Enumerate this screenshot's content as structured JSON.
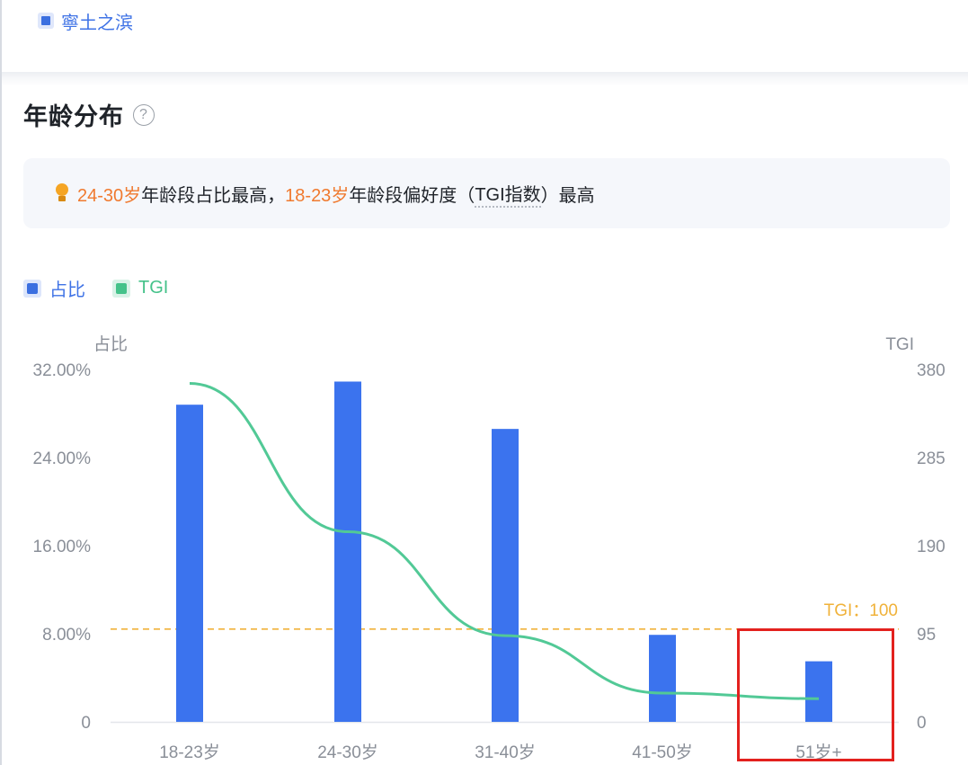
{
  "top_tag": {
    "label": "寧土之滨",
    "icon": "square-tag-icon"
  },
  "section": {
    "title": "年龄分布",
    "help_icon_glyph": "?"
  },
  "insight": {
    "icon": "lightbulb-icon",
    "part1": "24-30岁",
    "part2": "年龄段占比最高，",
    "part3": "18-23岁",
    "part4": "年龄段偏好度（",
    "part5": "TGI指数",
    "part6": "）最高"
  },
  "legend": {
    "share_label": "占比",
    "tgi_label": "TGI"
  },
  "colors": {
    "bar": "#3b73ee",
    "line": "#52c996",
    "reference": "#f0b23a",
    "highlight": "#e3211e",
    "accent_text": "#f07a2f"
  },
  "chart_data": {
    "type": "bar+line",
    "categories": [
      "18-23岁",
      "24-30岁",
      "31-40岁",
      "41-50岁",
      "51岁+"
    ],
    "series": [
      {
        "name": "占比",
        "type": "bar",
        "axis": "left",
        "values": [
          28.8,
          30.9,
          26.6,
          7.9,
          5.5
        ]
      },
      {
        "name": "TGI",
        "type": "line",
        "axis": "right",
        "values": [
          365,
          205,
          93,
          31,
          25
        ]
      }
    ],
    "left_axis": {
      "label": "占比",
      "ticks": [
        "0",
        "8.00%",
        "16.00%",
        "24.00%",
        "32.00%"
      ],
      "min": 0,
      "max": 32
    },
    "right_axis": {
      "label": "TGI",
      "ticks": [
        "0",
        "95",
        "190",
        "285",
        "380"
      ],
      "min": 0,
      "max": 380
    },
    "reference_line": {
      "axis": "right",
      "value": 100,
      "label": "TGI：100"
    },
    "highlighted_category": "51岁+",
    "grid": false,
    "legend_position": "top-left"
  }
}
